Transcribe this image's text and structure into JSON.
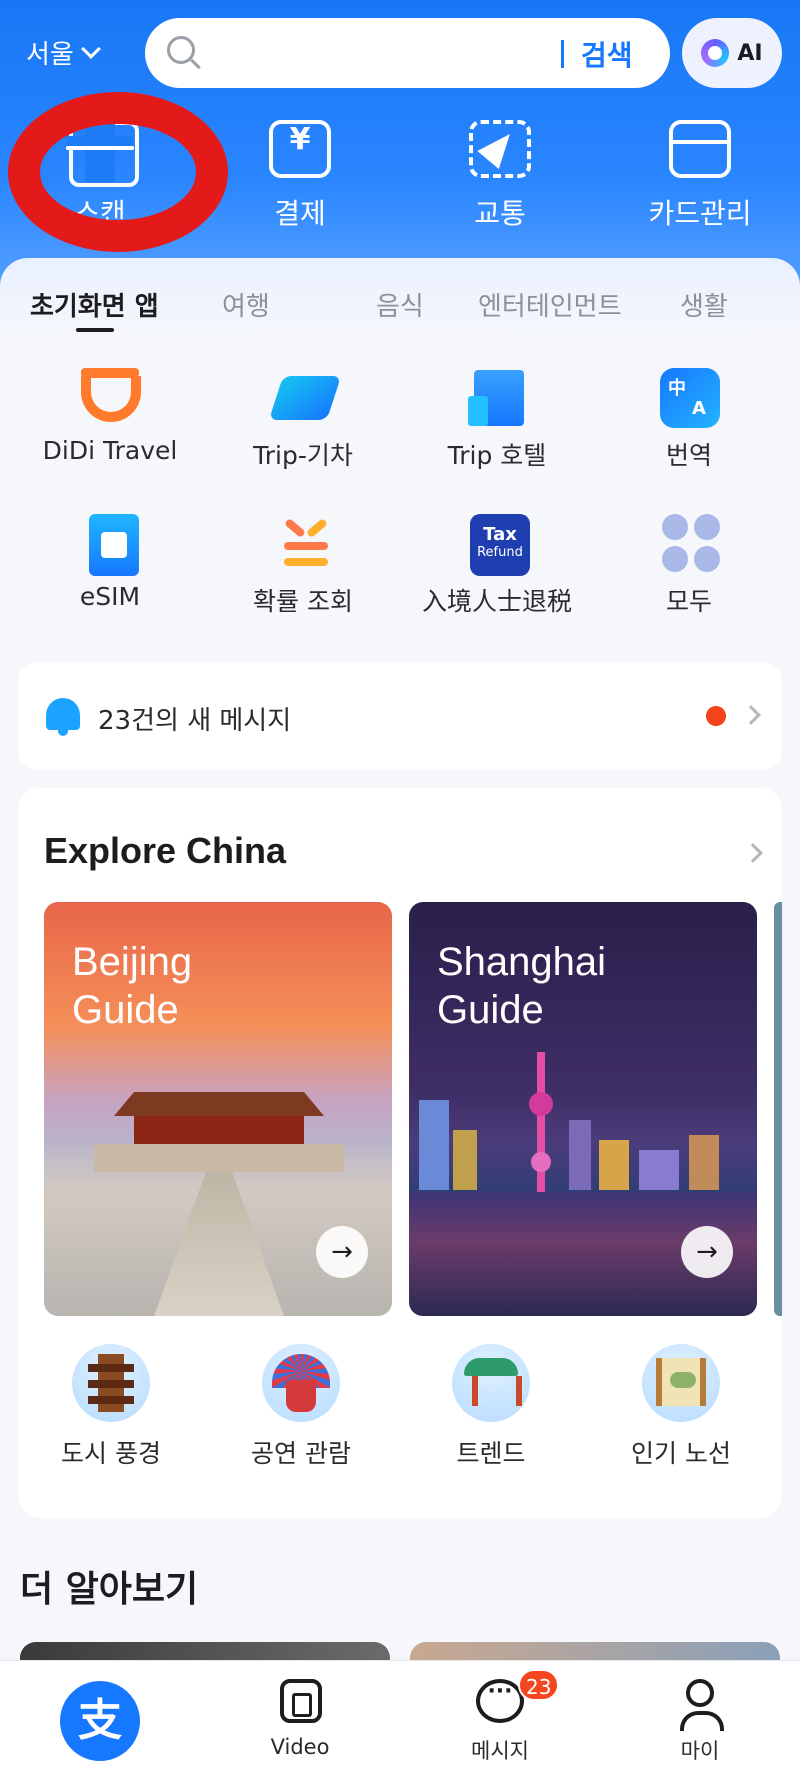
{
  "header": {
    "city": "서울",
    "search_button": "검색",
    "ai_label": "AI"
  },
  "quick_actions": [
    {
      "label": "스캔",
      "icon": "scan-icon"
    },
    {
      "label": "결제",
      "icon": "payment-icon"
    },
    {
      "label": "교통",
      "icon": "transport-icon"
    },
    {
      "label": "카드관리",
      "icon": "card-wallet-icon"
    }
  ],
  "tabs": [
    {
      "label": "초기화면 앱",
      "active": true
    },
    {
      "label": "여행",
      "active": false
    },
    {
      "label": "음식",
      "active": false
    },
    {
      "label": "엔터테인먼트",
      "active": false
    },
    {
      "label": "생활",
      "active": false
    }
  ],
  "apps": [
    {
      "label": "DiDi Travel",
      "icon": "didi-icon"
    },
    {
      "label": "Trip-기차",
      "icon": "train-icon"
    },
    {
      "label": "Trip 호텔",
      "icon": "hotel-icon"
    },
    {
      "label": "번역",
      "icon": "translate-icon"
    },
    {
      "label": "eSIM",
      "icon": "esim-icon"
    },
    {
      "label": "확률 조회",
      "icon": "exchange-rate-icon"
    },
    {
      "label": "入境人士退税",
      "icon": "tax-refund-icon"
    },
    {
      "label": "모두",
      "icon": "more-apps-icon"
    }
  ],
  "translate_icon_text": {
    "top": "中",
    "bottom": "A"
  },
  "tax_icon_text": {
    "top": "Tax",
    "bottom": "Refund"
  },
  "messages": {
    "text": "23건의 새 메시지",
    "has_unread": true
  },
  "explore": {
    "title": "Explore China",
    "guides": [
      {
        "title_line1": "Beijing",
        "title_line2": "Guide"
      },
      {
        "title_line1": "Shanghai",
        "title_line2": "Guide"
      }
    ],
    "categories": [
      {
        "label": "도시 풍경",
        "icon": "pagoda-icon"
      },
      {
        "label": "공연 관람",
        "icon": "opera-icon"
      },
      {
        "label": "트렌드",
        "icon": "pavilion-icon"
      },
      {
        "label": "인기 노선",
        "icon": "scroll-map-icon"
      }
    ]
  },
  "more_section": {
    "title": "더 알아보기"
  },
  "bottom_nav": [
    {
      "label": "",
      "icon": "alipay-home-icon"
    },
    {
      "label": "Video",
      "icon": "video-icon"
    },
    {
      "label": "메시지",
      "icon": "message-icon",
      "badge": "23"
    },
    {
      "label": "마이",
      "icon": "profile-icon"
    }
  ],
  "colors": {
    "brand_blue": "#1677ff",
    "annotation_red": "#e41a1a",
    "badge_red": "#f4461f"
  }
}
